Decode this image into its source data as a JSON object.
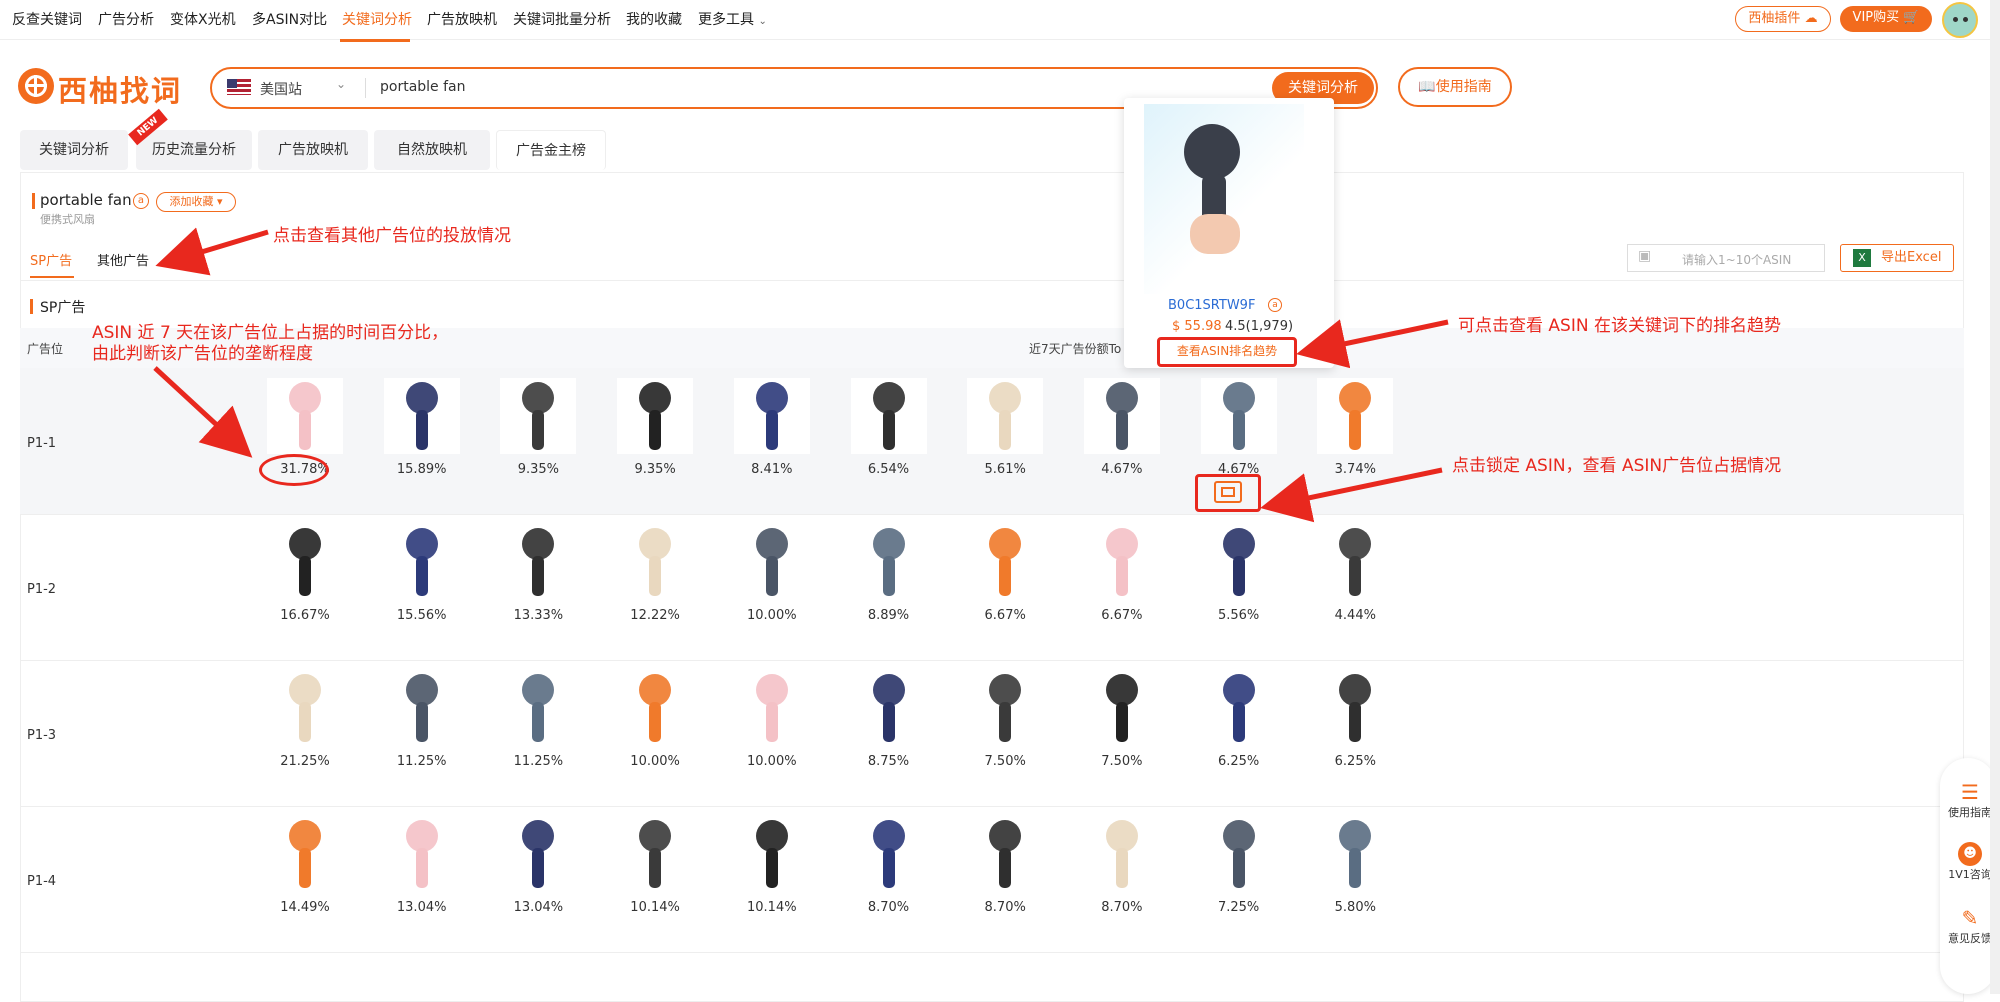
{
  "nav": {
    "items": [
      "反查关键词",
      "广告分析",
      "变体X光机",
      "多ASIN对比",
      "关键词分析",
      "广告放映机",
      "关键词批量分析",
      "我的收藏",
      "更多工具"
    ],
    "plugin_label": "西柚插件",
    "vip_label": "VIP购买"
  },
  "brand": {
    "name": "西柚找词"
  },
  "search": {
    "site": "美国站",
    "query": "portable fan",
    "button": "关键词分析",
    "guide": "使用指南"
  },
  "tabs": [
    "关键词分析",
    "历史流量分析",
    "广告放映机",
    "自然放映机",
    "广告金主榜"
  ],
  "new_badge": "NEW",
  "keyword": {
    "title": "portable fan",
    "subtitle": "便携式风扇",
    "favorite": "添加收藏"
  },
  "subtabs": [
    "SP广告",
    "其他广告"
  ],
  "asin_input_placeholder": "请输入1~10个ASIN",
  "export_label": "导出Excel",
  "section_title": "SP广告",
  "table": {
    "col_position": "广告位",
    "col_share": "近7天广告份额To"
  },
  "popup": {
    "asin": "B0C1SRTW9F",
    "price": "$ 55.98",
    "rating": "4.5(1,979)",
    "button": "查看ASIN排名趋势"
  },
  "annotations": {
    "other_ads": "点击查看其他广告位的投放情况",
    "share_line1": "ASIN 近 7 天在该广告位上占据的时间百分比，",
    "share_line2": "由此判断该广告位的垄断程度",
    "trend": "可点击查看 ASIN 在该关键词下的排名趋势",
    "lock": "点击锁定 ASIN，查看 ASIN广告位占据情况"
  },
  "rows": [
    {
      "label": "P1-1",
      "values": [
        "31.78%",
        "15.89%",
        "9.35%",
        "9.35%",
        "8.41%",
        "6.54%",
        "5.61%",
        "4.67%",
        "4.67%",
        "3.74%"
      ]
    },
    {
      "label": "P1-2",
      "values": [
        "16.67%",
        "15.56%",
        "13.33%",
        "12.22%",
        "10.00%",
        "8.89%",
        "6.67%",
        "6.67%",
        "5.56%",
        "4.44%"
      ]
    },
    {
      "label": "P1-3",
      "values": [
        "21.25%",
        "11.25%",
        "11.25%",
        "10.00%",
        "10.00%",
        "8.75%",
        "7.50%",
        "7.50%",
        "6.25%",
        "6.25%"
      ]
    },
    {
      "label": "P1-4",
      "values": [
        "14.49%",
        "13.04%",
        "13.04%",
        "10.14%",
        "10.14%",
        "8.70%",
        "8.70%",
        "8.70%",
        "7.25%",
        "5.80%"
      ]
    }
  ],
  "side": {
    "guide": "使用指南",
    "consult": "1V1咨询",
    "feedback": "意见反馈"
  },
  "colors": {
    "accent": "#f26b1d",
    "annotation": "#e8281e"
  }
}
